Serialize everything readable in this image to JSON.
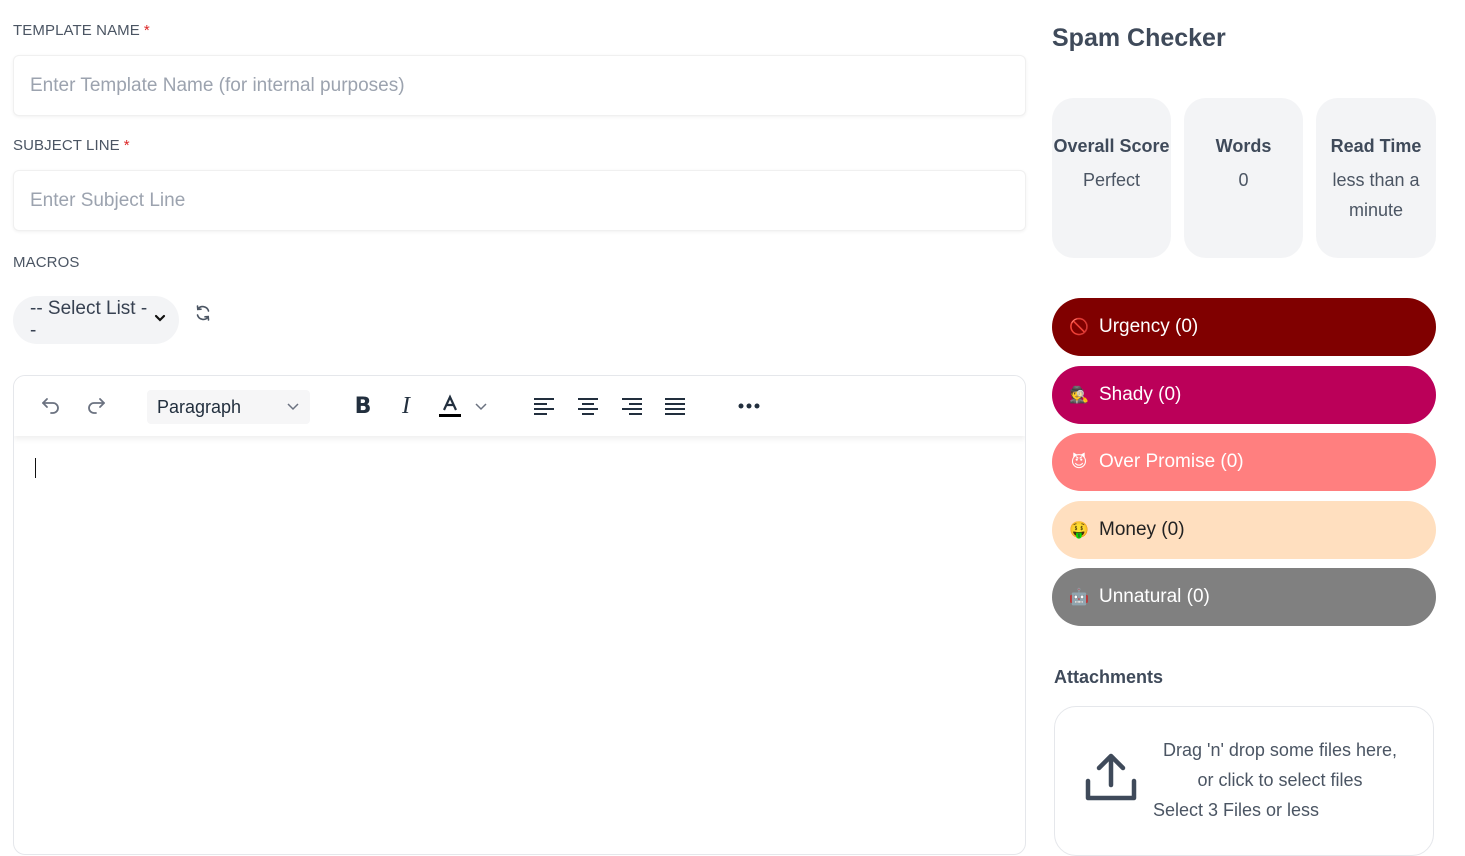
{
  "form": {
    "template_name": {
      "label": "TEMPLATE NAME",
      "required_mark": "*",
      "value": "",
      "placeholder": "Enter Template Name (for internal purposes)"
    },
    "subject_line": {
      "label": "SUBJECT LINE",
      "required_mark": "*",
      "value": "",
      "placeholder": "Enter Subject Line"
    },
    "macros": {
      "label": "MACROS",
      "select_value": "-- Select List --"
    }
  },
  "editor": {
    "block_format": "Paragraph",
    "toolbar_icons": [
      "undo-icon",
      "redo-icon",
      "bold-icon",
      "italic-icon",
      "text-color-icon",
      "align-left-icon",
      "align-center-icon",
      "align-right-icon",
      "align-justify-icon",
      "more-icon"
    ],
    "content": ""
  },
  "spam_checker": {
    "title": "Spam Checker",
    "stats": [
      {
        "label": "Overall Score",
        "value": "Perfect"
      },
      {
        "label": "Words",
        "value": "0"
      },
      {
        "label": "Read Time",
        "value": "less than a minute"
      }
    ],
    "categories": [
      {
        "label": "Urgency (0)",
        "icon": "no-entry-icon",
        "emoji": "🚫",
        "bg": "#800000",
        "fg": "#ffffff"
      },
      {
        "label": "Shady (0)",
        "icon": "detective-icon",
        "emoji": "🕵️",
        "bg": "#bb0059",
        "fg": "#ffffff"
      },
      {
        "label": "Over Promise (0)",
        "icon": "devil-icon",
        "emoji": "😈",
        "bg": "#ff7f7f",
        "fg": "#ffffff"
      },
      {
        "label": "Money (0)",
        "icon": "money-face-icon",
        "emoji": "🤑",
        "bg": "#ffdfbf",
        "fg": "#222222"
      },
      {
        "label": "Unnatural (0)",
        "icon": "robot-icon",
        "emoji": "🤖",
        "bg": "#808080",
        "fg": "#ffffff"
      }
    ]
  },
  "attachments": {
    "title": "Attachments",
    "drop_text": "Drag 'n' drop some files here, or click to select files",
    "limit_text": "Select 3 Files or less"
  }
}
